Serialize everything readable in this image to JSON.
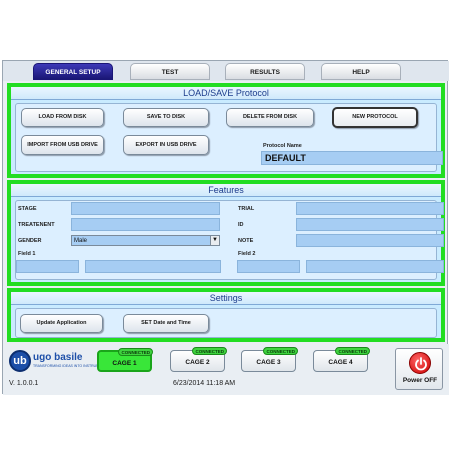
{
  "tabs": [
    {
      "label": "GENERAL SETUP",
      "active": true
    },
    {
      "label": "TEST",
      "active": false
    },
    {
      "label": "RESULTS",
      "active": false
    },
    {
      "label": "HELP",
      "active": false
    }
  ],
  "load_save": {
    "title": "LOAD/SAVE Protocol",
    "load_button": "LOAD FROM DISK",
    "save_button": "SAVE TO DISK",
    "delete_button": "DELETE FROM DISK",
    "new_button": "NEW PROTOCOL",
    "import_button": "IMPORT FROM USB DRIVE",
    "export_button": "EXPORT IN USB DRIVE",
    "protocol_name_label": "Protocol Name",
    "protocol_name_value": "DEFAULT"
  },
  "features": {
    "title": "Features",
    "stage_label": "STAGE",
    "stage_value": "",
    "treatment_label": "TREATENENT",
    "treatment_value": "",
    "gender_label": "GENDER",
    "gender_value": "Male",
    "field1_label": "Field 1",
    "trial_label": "TRIAL",
    "trial_value": "",
    "id_label": "ID",
    "id_value": "",
    "note_label": "NOTE",
    "note_value": "",
    "field2_label": "Field 2"
  },
  "settings": {
    "title": "Settings",
    "update_button": "Update Application",
    "datetime_button": "SET Date and Time"
  },
  "footer": {
    "logo_letters": "ub",
    "logo_name": "ugo basile",
    "logo_tagline": "TRANSFORMING IDEAS INTO INSTRUMENTS",
    "version": "V. 1.0.0.1",
    "datetime": "6/23/2014 11:18 AM",
    "power_label": "Power OFF",
    "cages": [
      {
        "label": "CAGE 1",
        "status": "CONNECTED",
        "active": true
      },
      {
        "label": "CAGE 2",
        "status": "CONNECTED",
        "active": false
      },
      {
        "label": "CAGE 3",
        "status": "CONNECTED",
        "active": false
      },
      {
        "label": "CAGE 4",
        "status": "CONNECTED",
        "active": false
      }
    ]
  },
  "colors": {
    "panel_border": "#22dd22",
    "active_tab": "#1a1676",
    "field_fill": "#a6cdf3",
    "active_cage": "#39e639",
    "power_red": "#cc0000"
  },
  "icons": [
    "chevron-down-icon",
    "power-icon",
    "ugo-basile-logo"
  ]
}
